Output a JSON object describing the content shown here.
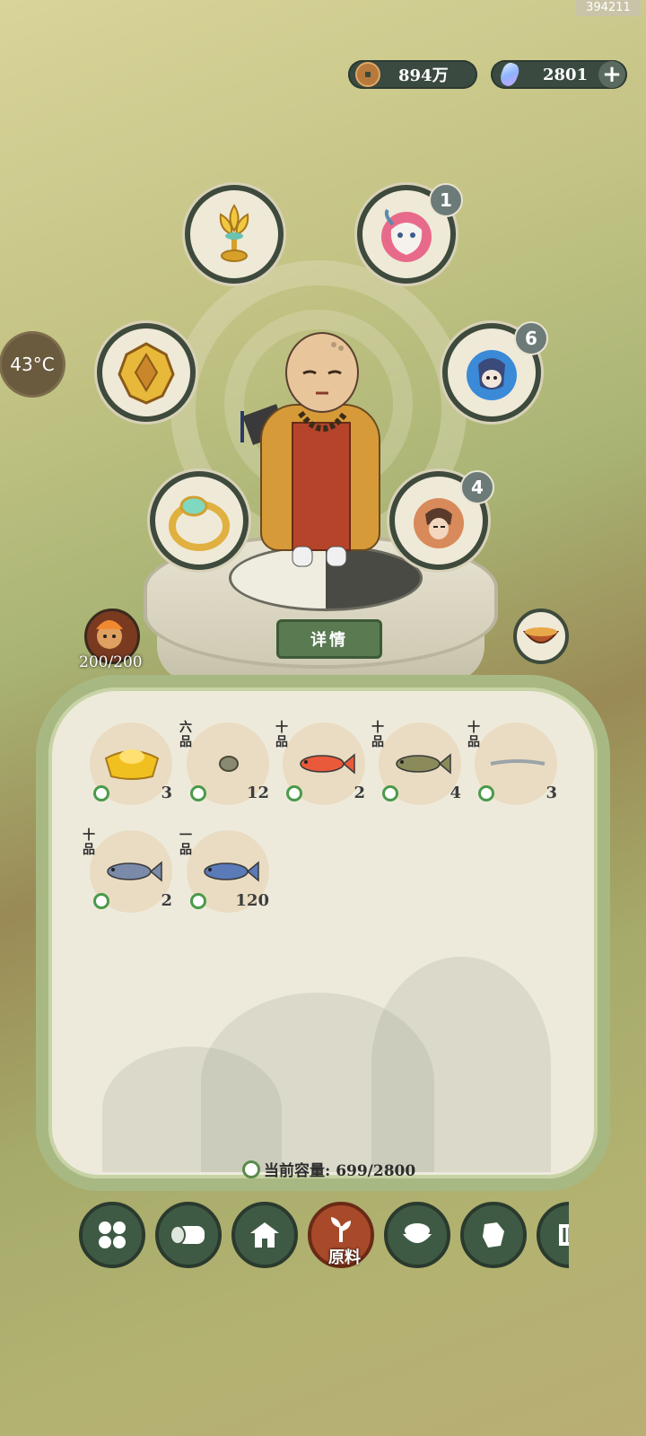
{
  "watermark": "394211",
  "resources": {
    "coins": "894万",
    "gems": "2801"
  },
  "temperature": "43°C",
  "equipment": {
    "lotus_badge": "",
    "spirit_left_badge": "1",
    "spirit_right_badge": "6",
    "spirit_bottom_badge": "4"
  },
  "details_button": "详情",
  "hp": "200/200",
  "inventory": [
    {
      "grade": "",
      "count": "3",
      "icon": "gold-ingot-icon",
      "color": "#f0c020"
    },
    {
      "grade": "六品",
      "count": "12",
      "icon": "clam-icon",
      "color": "#8a8a70"
    },
    {
      "grade": "十品",
      "count": "2",
      "icon": "red-fish-icon",
      "color": "#e85a3a"
    },
    {
      "grade": "十品",
      "count": "4",
      "icon": "spotted-fish-icon",
      "color": "#8a8a5a"
    },
    {
      "grade": "十品",
      "count": "3",
      "icon": "eel-icon",
      "color": "#9aa4a8"
    },
    {
      "grade": "十品",
      "count": "2",
      "icon": "silver-fish-icon",
      "color": "#7a8aa8"
    },
    {
      "grade": "一品",
      "count": "120",
      "icon": "dragon-fish-icon",
      "color": "#5a7ab8"
    }
  ],
  "capacity": "当前容量: 699/2800",
  "tabs": [
    {
      "name": "tab-all",
      "label": ""
    },
    {
      "name": "tab-wood",
      "label": ""
    },
    {
      "name": "tab-building",
      "label": ""
    },
    {
      "name": "tab-ingredients",
      "label": "原料"
    },
    {
      "name": "tab-food",
      "label": ""
    },
    {
      "name": "tab-map",
      "label": ""
    },
    {
      "name": "tab-scroll",
      "label": ""
    }
  ]
}
